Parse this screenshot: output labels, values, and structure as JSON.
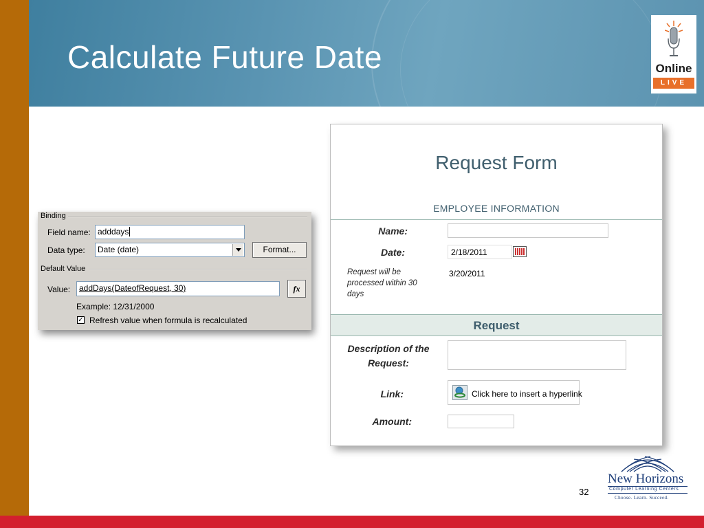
{
  "slide": {
    "title": "Calculate Future Date",
    "page_number": "32"
  },
  "logos": {
    "online_live": {
      "line1": "Online",
      "line2": "LIVE"
    },
    "new_horizons": {
      "name": "New Horizons",
      "tagline1": "Computer Learning Centers",
      "tagline2": "Choose. Learn. Succeed."
    }
  },
  "binding_dialog": {
    "group_binding": "Binding",
    "field_name_label": "Field name:",
    "field_name_value": "adddays",
    "data_type_label": "Data type:",
    "data_type_value": "Date (date)",
    "format_button": "Format...",
    "group_default": "Default Value",
    "value_label": "Value:",
    "value_formula": "addDays(DateofRequest, 30)",
    "fx_button": "fx",
    "example_text": "Example: 12/31/2000",
    "refresh_checkbox_label": "Refresh value when formula is recalculated",
    "refresh_checked": true
  },
  "request_form": {
    "title": "Request Form",
    "section_employee": "EMPLOYEE INFORMATION",
    "name_label": "Name:",
    "name_value": "",
    "date_label": "Date:",
    "date_value": "2/18/2011",
    "note_line1": "Request will be",
    "note_line2": "processed within 30",
    "note_line3": "days",
    "processed_date": "3/20/2011",
    "section_request": "Request",
    "description_label_line1": "Description of the",
    "description_label_line2": "Request:",
    "link_label": "Link:",
    "hyperlink_text": "Click here to insert a hyperlink",
    "amount_label": "Amount:"
  },
  "colors": {
    "left_bar": "#b56a08",
    "bottom_bar": "#d31f2e",
    "header_blue": "#5a94b2",
    "form_heading": "#3f5e6d"
  }
}
